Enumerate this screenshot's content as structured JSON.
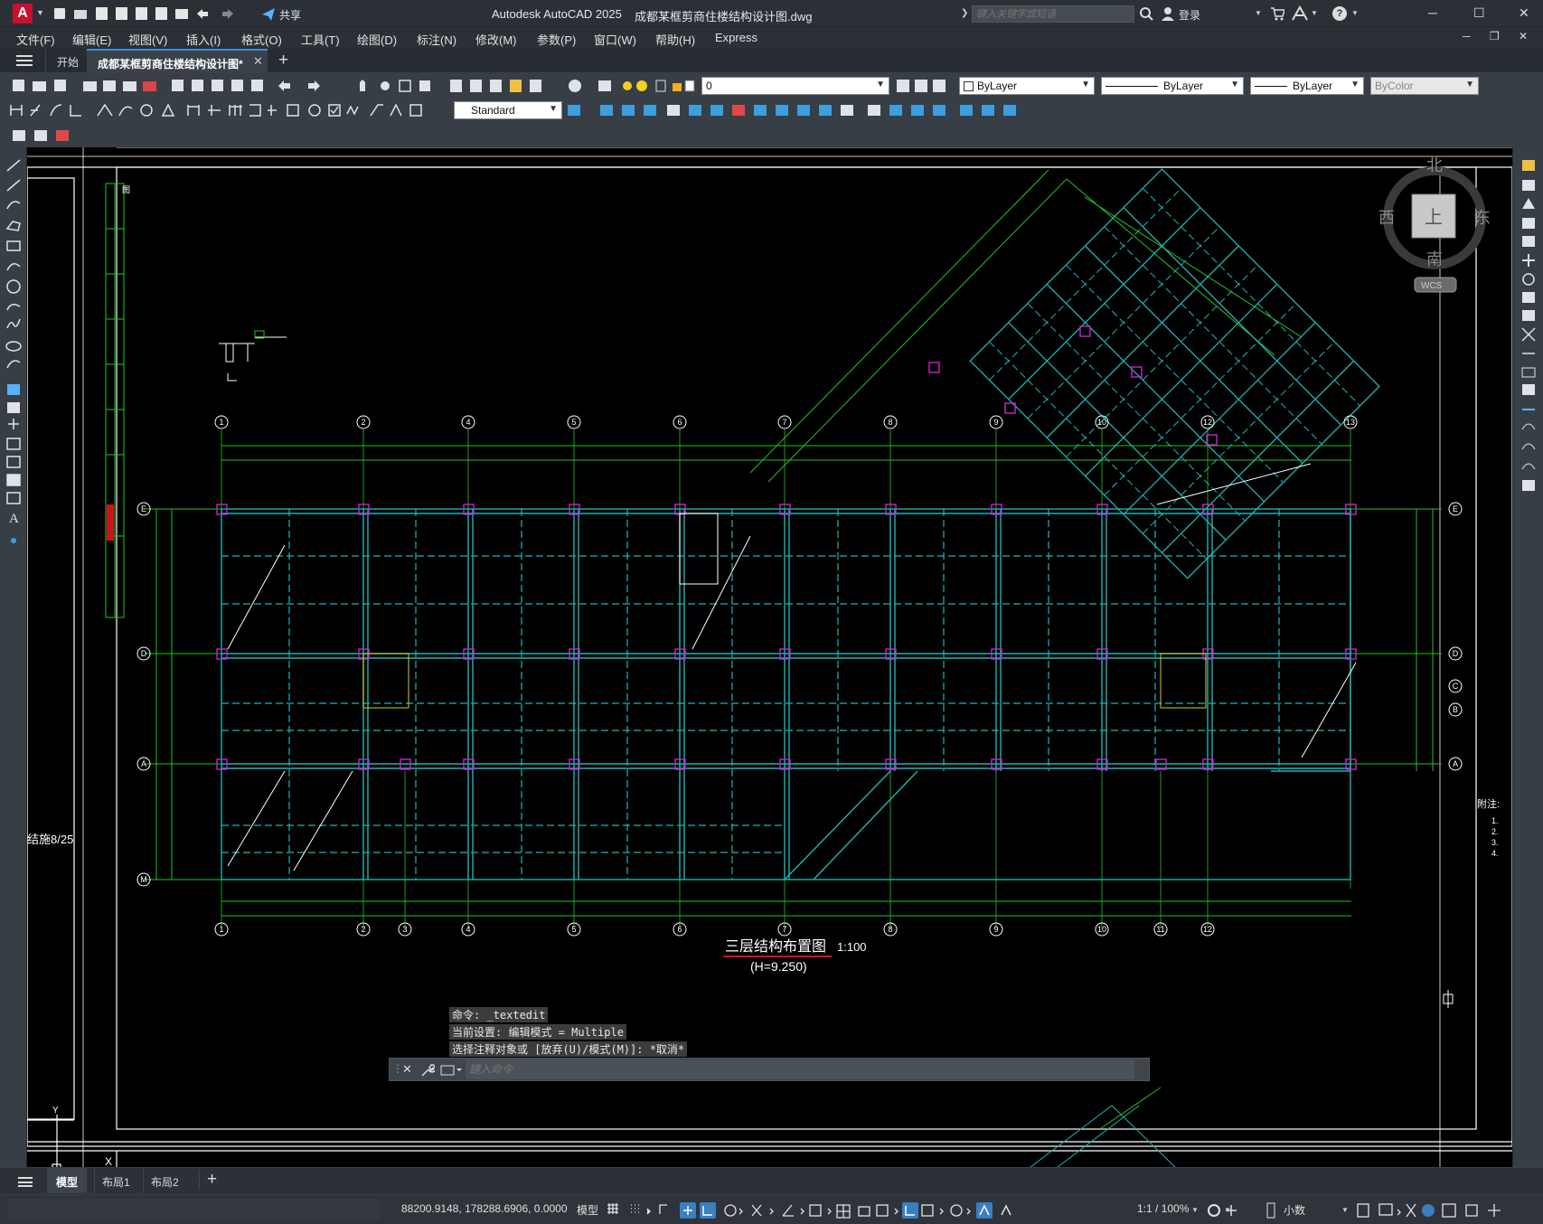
{
  "app": {
    "logo_letter": "A",
    "share_label": "共享",
    "title": "Autodesk AutoCAD 2025",
    "filename": "成都某框剪商住楼结构设计图.dwg",
    "search_placeholder": "键入关键字或短语",
    "login_label": "登录"
  },
  "menu": [
    "文件(F)",
    "编辑(E)",
    "视图(V)",
    "插入(I)",
    "格式(O)",
    "工具(T)",
    "绘图(D)",
    "标注(N)",
    "修改(M)",
    "参数(P)",
    "窗口(W)",
    "帮助(H)",
    "Express"
  ],
  "tabs": {
    "start": "开始",
    "active": "成都某框剪商住楼结构设计图*"
  },
  "toolbar": {
    "layer_value": "0",
    "color_value": "ByLayer",
    "linetype_value": "ByLayer",
    "lineweight_value": "ByLayer",
    "plotstyle_value": "ByColor",
    "textstyle_value": "Standard"
  },
  "viewcube": {
    "north": "北",
    "south": "南",
    "east": "东",
    "west": "西",
    "top": "上",
    "wcs": "WCS"
  },
  "drawing": {
    "title": "三层结构布置图",
    "scale": "1:100",
    "elevation": "(H=9.250)",
    "note_label": "附注:",
    "left_cut_text": "结施8/25",
    "axes_bottom": [
      "1",
      "2",
      "3",
      "4",
      "5",
      "6",
      "7",
      "8",
      "9",
      "10",
      "11",
      "12"
    ],
    "axes_top": [
      "1",
      "2",
      "4",
      "5",
      "6",
      "7",
      "8",
      "9",
      "10",
      "12",
      "13"
    ],
    "axes_right": [
      "E",
      "D",
      "C",
      "B",
      "A"
    ],
    "axes_left": [
      "E",
      "D",
      "A",
      "M"
    ]
  },
  "command": {
    "line1": "命令: _textedit",
    "line2": "当前设置: 编辑模式 = Multiple",
    "line3": "选择注释对象或 [放弃(U)/模式(M)]: *取消*",
    "placeholder": "键入命令"
  },
  "layouts": [
    "模型",
    "布局1",
    "布局2"
  ],
  "status": {
    "coords": "88200.9148, 178288.6906, 0.0000",
    "model": "模型",
    "scale": "1:1 / 100%",
    "units": "小数"
  }
}
